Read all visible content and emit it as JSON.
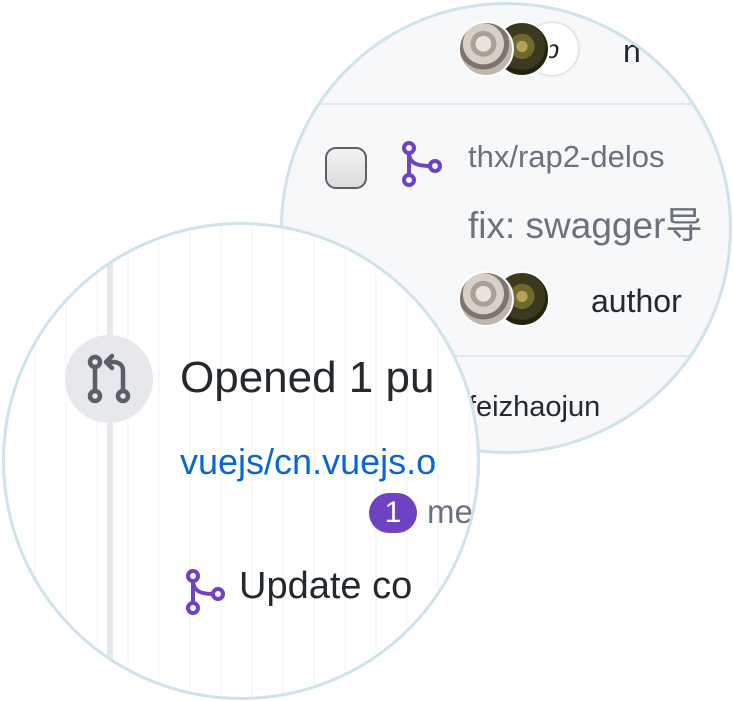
{
  "right_panel": {
    "top_row_text_fragment": "n",
    "avatar_glyph": "p",
    "item": {
      "repo": "thx/rap2-delos",
      "title": "fix: swagger导",
      "author_label": "author",
      "next_row_text": "feizhaojun"
    }
  },
  "left_panel": {
    "heading": "Opened 1 pu",
    "repo_link": "vuejs/cn.vuejs.o",
    "badge_count": "1",
    "badge_text": "me",
    "pr_title": "Update co"
  },
  "colors": {
    "link": "#0a66d6",
    "merge_icon": "#6f42c1",
    "muted_text": "#6a737d",
    "lens_border": "#cfe3ea"
  }
}
